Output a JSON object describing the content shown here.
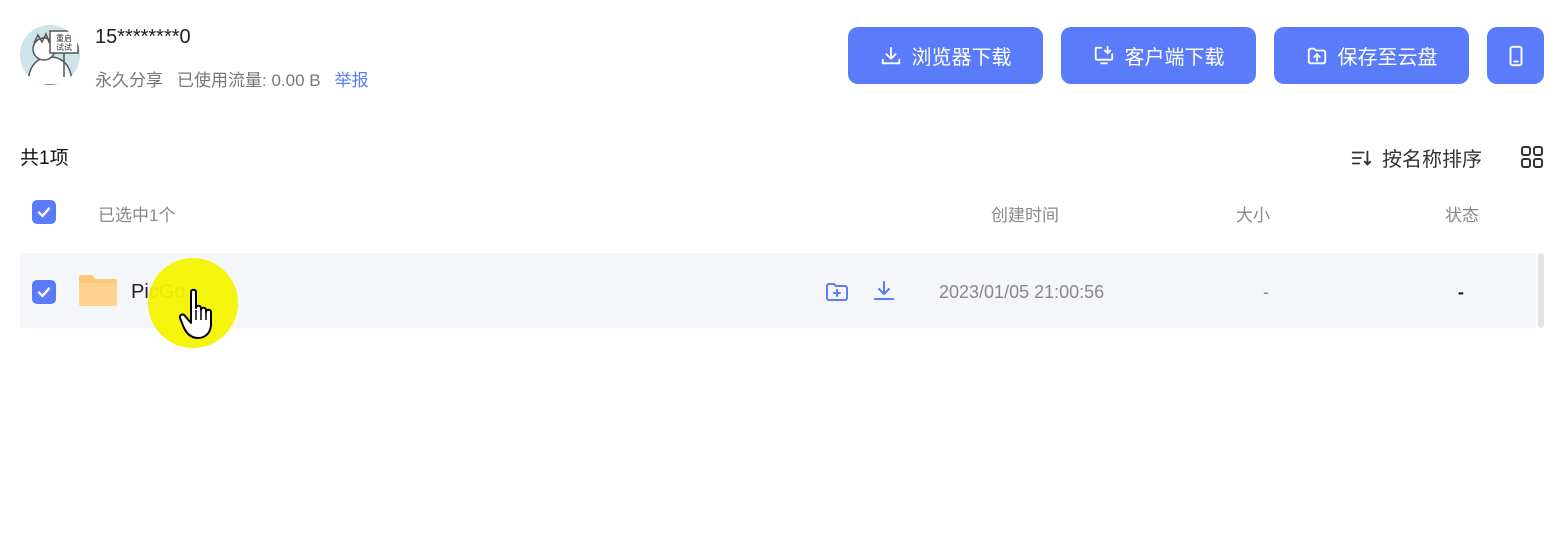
{
  "user": {
    "masked_phone": "15********0",
    "share_type": "永久分享",
    "traffic_label": "已使用流量: 0.00 B",
    "report_label": "举报",
    "avatar_sign_text": "重启试试"
  },
  "actions": {
    "browser_download": "浏览器下载",
    "client_download": "客户端下载",
    "save_to_cloud": "保存至云盘"
  },
  "toolbar": {
    "total_label": "共1项",
    "sort_label": "按名称排序"
  },
  "table": {
    "headers": {
      "selected": "已选中1个",
      "created": "创建时间",
      "size": "大小",
      "status": "状态"
    },
    "rows": [
      {
        "name": "PicGo",
        "created": "2023/01/05 21:00:56",
        "size": "-",
        "status": "-",
        "checked": true
      }
    ]
  },
  "colors": {
    "accent": "#5b7cfa",
    "row_bg": "#f5f6fa",
    "folder": "#ffc874",
    "cursor_highlight": "#f3f300"
  }
}
